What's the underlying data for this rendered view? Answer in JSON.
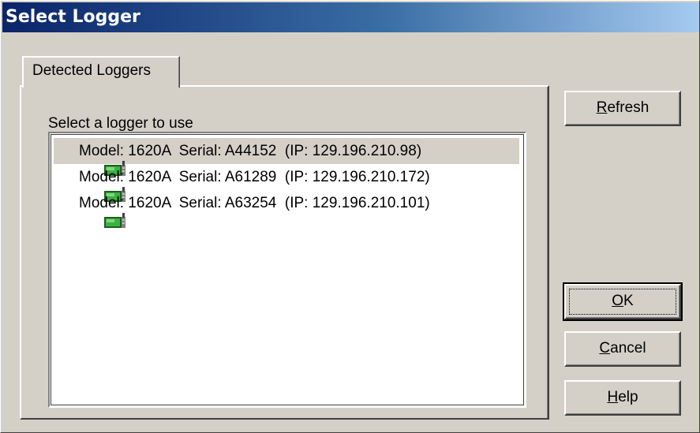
{
  "window": {
    "title": "Select Logger"
  },
  "tabs": [
    {
      "label": "Detected Loggers",
      "active": true
    }
  ],
  "panel": {
    "instruction": "Select a logger to use"
  },
  "loggers": [
    {
      "text": "Model: 1620A  Serial: A44152  (IP: 129.196.210.98)",
      "selected": true,
      "icon": "logger-device-icon"
    },
    {
      "text": "Model: 1620A  Serial: A61289  (IP: 129.196.210.172)",
      "selected": false,
      "icon": "logger-device-icon"
    },
    {
      "text": "Model: 1620A  Serial: A63254  (IP: 129.196.210.101)",
      "selected": false,
      "icon": "logger-device-icon"
    }
  ],
  "buttons": {
    "refresh": {
      "mnemonic": "R",
      "rest": "efresh"
    },
    "ok": {
      "mnemonic": "O",
      "rest": "K",
      "default": true
    },
    "cancel": {
      "mnemonic": "C",
      "rest": "ancel"
    },
    "help": {
      "mnemonic": "H",
      "rest": "elp"
    }
  },
  "colors": {
    "title_gradient_start": "#0a246a",
    "title_gradient_end": "#a6caf0",
    "face": "#d4d0c8",
    "icon_green": "#2e8b2e"
  }
}
